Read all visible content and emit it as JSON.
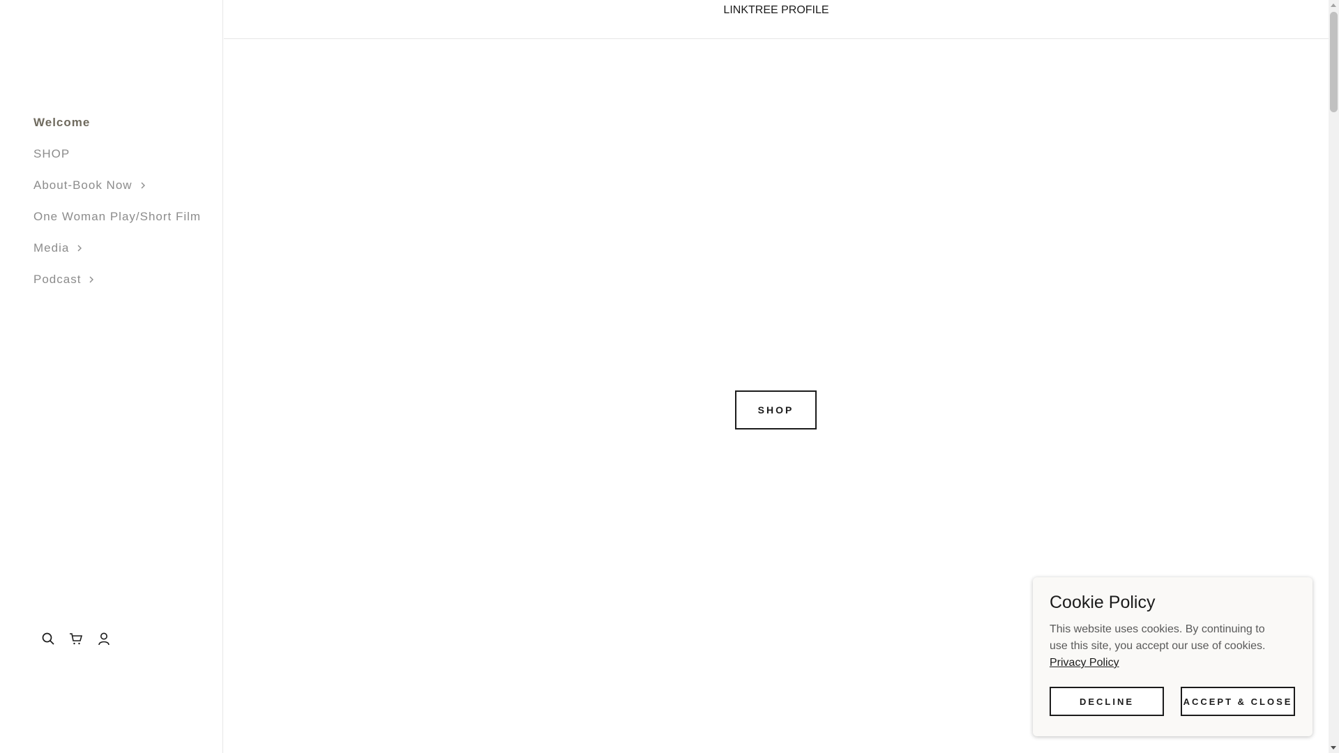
{
  "sidebar": {
    "nav": [
      {
        "label": "Welcome",
        "has_submenu": false,
        "active": true
      },
      {
        "label": "SHOP",
        "has_submenu": false,
        "active": false
      },
      {
        "label": "About-Book Now",
        "has_submenu": true,
        "active": false
      },
      {
        "label": "One Woman Play/Short Film",
        "has_submenu": false,
        "active": false
      },
      {
        "label": "Media",
        "has_submenu": true,
        "active": false
      },
      {
        "label": "Podcast",
        "has_submenu": true,
        "active": false
      }
    ],
    "icons": [
      "search-icon",
      "cart-icon",
      "account-icon"
    ]
  },
  "header": {
    "link": "LINKTREE PROFILE"
  },
  "main": {
    "shop_button": "SHOP"
  },
  "cookie": {
    "title": "Cookie Policy",
    "message": "This website uses cookies. By continuing to use this site, you accept our use of cookies.",
    "privacy_link": "Privacy Policy",
    "decline": "DECLINE",
    "accept": "ACCEPT & CLOSE"
  },
  "colors": {
    "active_nav": "#6f6a5e",
    "nav": "#8c8c8c",
    "text": "#1b1b1b",
    "cookie_bg": "#faf9f7"
  }
}
